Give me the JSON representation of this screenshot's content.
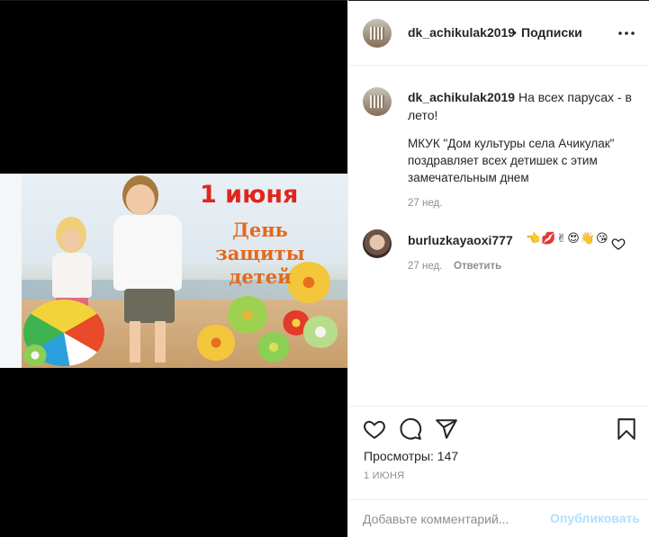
{
  "post": {
    "image_title_line1": "1 июня",
    "image_title_line2": "День защиты детей"
  },
  "header": {
    "username": "dk_achikulak2019",
    "separator": "•",
    "follow_label": "Подписки",
    "more_icon": "more-horizontal-icon"
  },
  "caption": {
    "username": "dk_achikulak2019",
    "text_line1": "На всех парусах - в лето!",
    "text_body": "МКУК \"Дом культуры села Ачикулак\" поздравляет всех детишек с этим замечательным днем",
    "time": "27 нед."
  },
  "comments": [
    {
      "username": "burluzkayaoxi777",
      "text": "👈💋✌😍👋😘",
      "time": "27 нед.",
      "reply_label": "Ответить"
    }
  ],
  "actions": {
    "like_icon": "heart-icon",
    "comment_icon": "comment-icon",
    "share_icon": "send-icon",
    "save_icon": "bookmark-icon",
    "views_label": "Просмотры:",
    "views_count": "147",
    "date": "1 ИЮНЯ"
  },
  "add_comment": {
    "placeholder": "Добавьте комментарий...",
    "publish_label": "Опубликовать"
  },
  "colors": {
    "accent_disabled": "#b2dffc",
    "secondary_text": "#8e8e8e",
    "primary_text": "#262626"
  }
}
